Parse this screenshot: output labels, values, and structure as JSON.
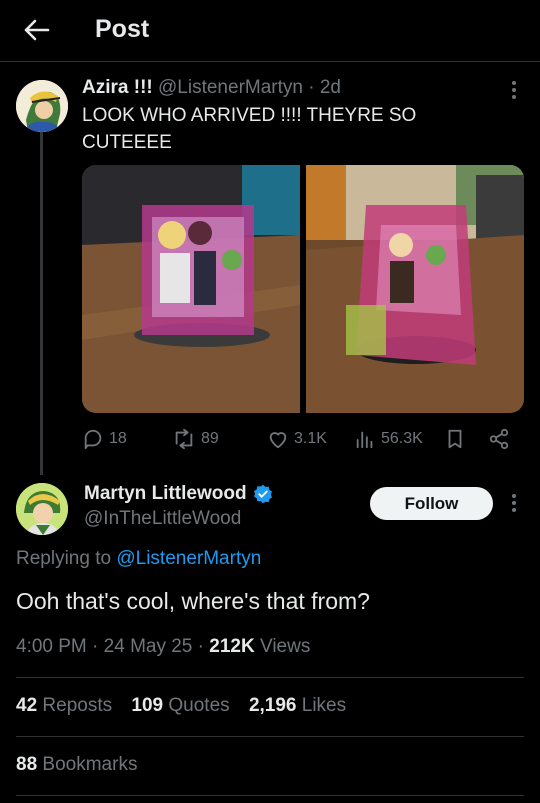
{
  "header": {
    "title": "Post"
  },
  "tweet1": {
    "name": "Azira !!!",
    "handle": "@ListenerMartyn",
    "dot": "·",
    "time": "2d",
    "text": "LOOK WHO ARRIVED !!!! THEYRE SO CUTEEEE",
    "actions": {
      "replies": "18",
      "reposts": "89",
      "likes": "3.1K",
      "views": "56.3K"
    }
  },
  "tweet2": {
    "name": "Martyn Littlewood",
    "handle": "@InTheLittleWood",
    "follow_label": "Follow",
    "replying_prefix": "Replying to",
    "replying_mention": "@ListenerMartyn",
    "text": "Ooh that's cool, where's that from?",
    "meta": {
      "time": "4:00 PM",
      "sep1": "·",
      "date": "24 May 25",
      "sep2": "·",
      "views_count": "212K",
      "views_label": "Views"
    },
    "stats": {
      "reposts_count": "42",
      "reposts_label": "Reposts",
      "quotes_count": "109",
      "quotes_label": "Quotes",
      "likes_count": "2,196",
      "likes_label": "Likes",
      "bookmarks_count": "88",
      "bookmarks_label": "Bookmarks"
    }
  },
  "colors": {
    "accent": "#1d9bf0",
    "verified": "#1d9bf0",
    "muted": "#71767b",
    "background": "#000000"
  }
}
